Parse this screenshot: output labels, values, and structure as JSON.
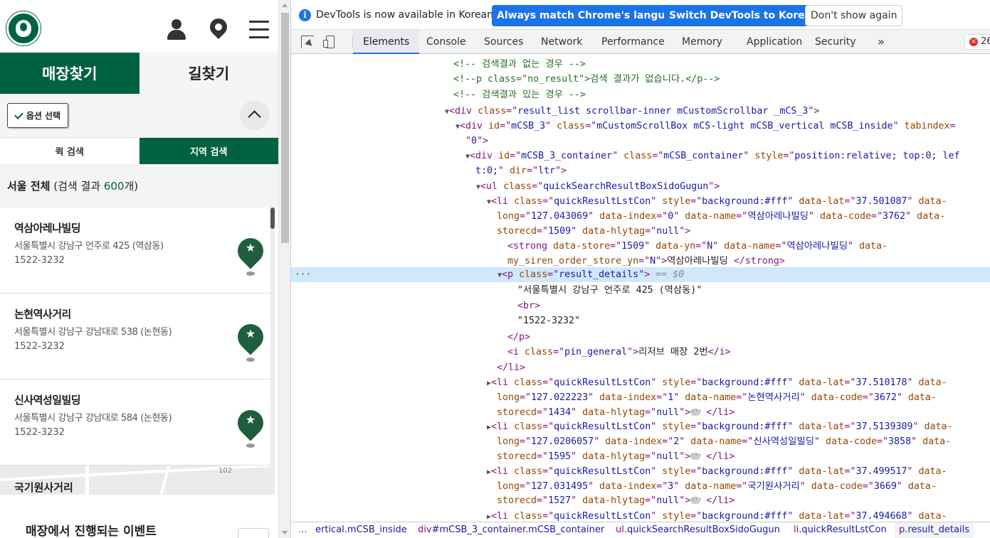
{
  "left": {
    "tabs_main": [
      "매장찾기",
      "길찾기"
    ],
    "option_button": "옵션 선택",
    "tabs_sub": [
      "퀵 검색",
      "지역 검색"
    ],
    "region": {
      "name": "서울 전체",
      "pre": "(검색 결과 ",
      "count": "600",
      "post": "개)"
    },
    "stores": [
      {
        "name": "역삼아레나빌딩",
        "address": "서울특별시 강남구 언주로 425 (역삼동)",
        "phone": "1522-3232"
      },
      {
        "name": "논현역사거리",
        "address": "서울특별시 강남구 강남대로 538 (논현동)",
        "phone": "1522-3232"
      },
      {
        "name": "신사역성일빌딩",
        "address": "서울특별시 강남구 강남대로 584 (논현동)",
        "phone": "1522-3232"
      }
    ],
    "partial_store": "국기원사거리",
    "map_number": "102",
    "event_title": "매장에서 진행되는 이벤트"
  },
  "devtools": {
    "info_text": "DevTools is now available in Korean!",
    "info_buttons": [
      "Always match Chrome's language",
      "Switch DevTools to Korean",
      "Don't show again"
    ],
    "tabs": [
      "Elements",
      "Console",
      "Sources",
      "Network",
      "Performance",
      "Memory",
      "Application",
      "Security"
    ],
    "more_tabs": "»",
    "error_count": "26",
    "code": {
      "comment1": "<!-- 검색결과 없는 경우 -->",
      "comment2": "<!--p class=\"no_result\">검색 결과가 없습니다.</p-->",
      "comment3": "<!-- 검색결과 있는 경우 -->",
      "div_result_class": "result_list scrollbar-inner mCustomScrollbar _mCS_3",
      "div_mcsb_id": "mCSB_3",
      "div_mcsb_class": "mCustomScrollBox mCS-light mCSB_vertical mCSB_inside",
      "div_mcsb_tabindex": "0",
      "div_cont_id": "mCSB_3_container",
      "div_cont_class": "mCSB_container",
      "div_cont_style_1": "position:relative; top:0; lef",
      "div_cont_style_2": "t:0;",
      "div_cont_dir": "ltr",
      "ul_class": "quickSearchResultBoxSidoGugun",
      "li_class": "quickResultLstCon",
      "li_style": "background:#fff",
      "li0": {
        "lat": "37.501087",
        "long": "127.043069",
        "index": "0",
        "name": "역삼아레나빌딩",
        "code": "3762",
        "storecd": "1509",
        "hlytag": "null"
      },
      "strong_store": "1509",
      "strong_yn": "N",
      "strong_name": "역삼아레나빌딩",
      "strong_siren": "N",
      "strong_text": "역삼아레나빌딩 ",
      "p_class": "result_details",
      "eq0": "== $0",
      "p_text1": "\"서울특별시 강남구 언주로 425 (역삼동)\"",
      "p_text2": "\"1522-3232\"",
      "i_class": "pin_general",
      "i_text": "리저브 매장 2번",
      "li1": {
        "lat": "37.510178",
        "long": "127.022223",
        "index": "1",
        "name": "논현역사거리",
        "code": "3672",
        "storecd": "1434",
        "hlytag": "null"
      },
      "li2": {
        "lat": "37.5139309",
        "long": "127.0206057",
        "index": "2",
        "name": "신사역성일빌딩",
        "code": "3858",
        "storecd": "1595",
        "hlytag": "null"
      },
      "li3": {
        "lat": "37.499517",
        "long": "127.031495",
        "index": "3",
        "name": "국기원사거리",
        "code": "3669",
        "storecd": "1527",
        "hlytag": "null"
      },
      "li4": {
        "lat": "37.494668"
      }
    },
    "breadcrumbs": [
      {
        "tag": "",
        "cls": "ertical.mCSB_inside"
      },
      {
        "tag": "div",
        "cls": "#mCSB_3_container.mCSB_container"
      },
      {
        "tag": "ul",
        "cls": ".quickSearchResultBoxSidoGugun"
      },
      {
        "tag": "li",
        "cls": ".quickResultLstCon"
      },
      {
        "tag": "p",
        "cls": ".result_details"
      }
    ],
    "crumb_dots": "..."
  },
  "colors": {
    "starbucks_green": "#006241",
    "devtools_blue": "#1a73e8",
    "selected_row": "#cfe8fc"
  }
}
